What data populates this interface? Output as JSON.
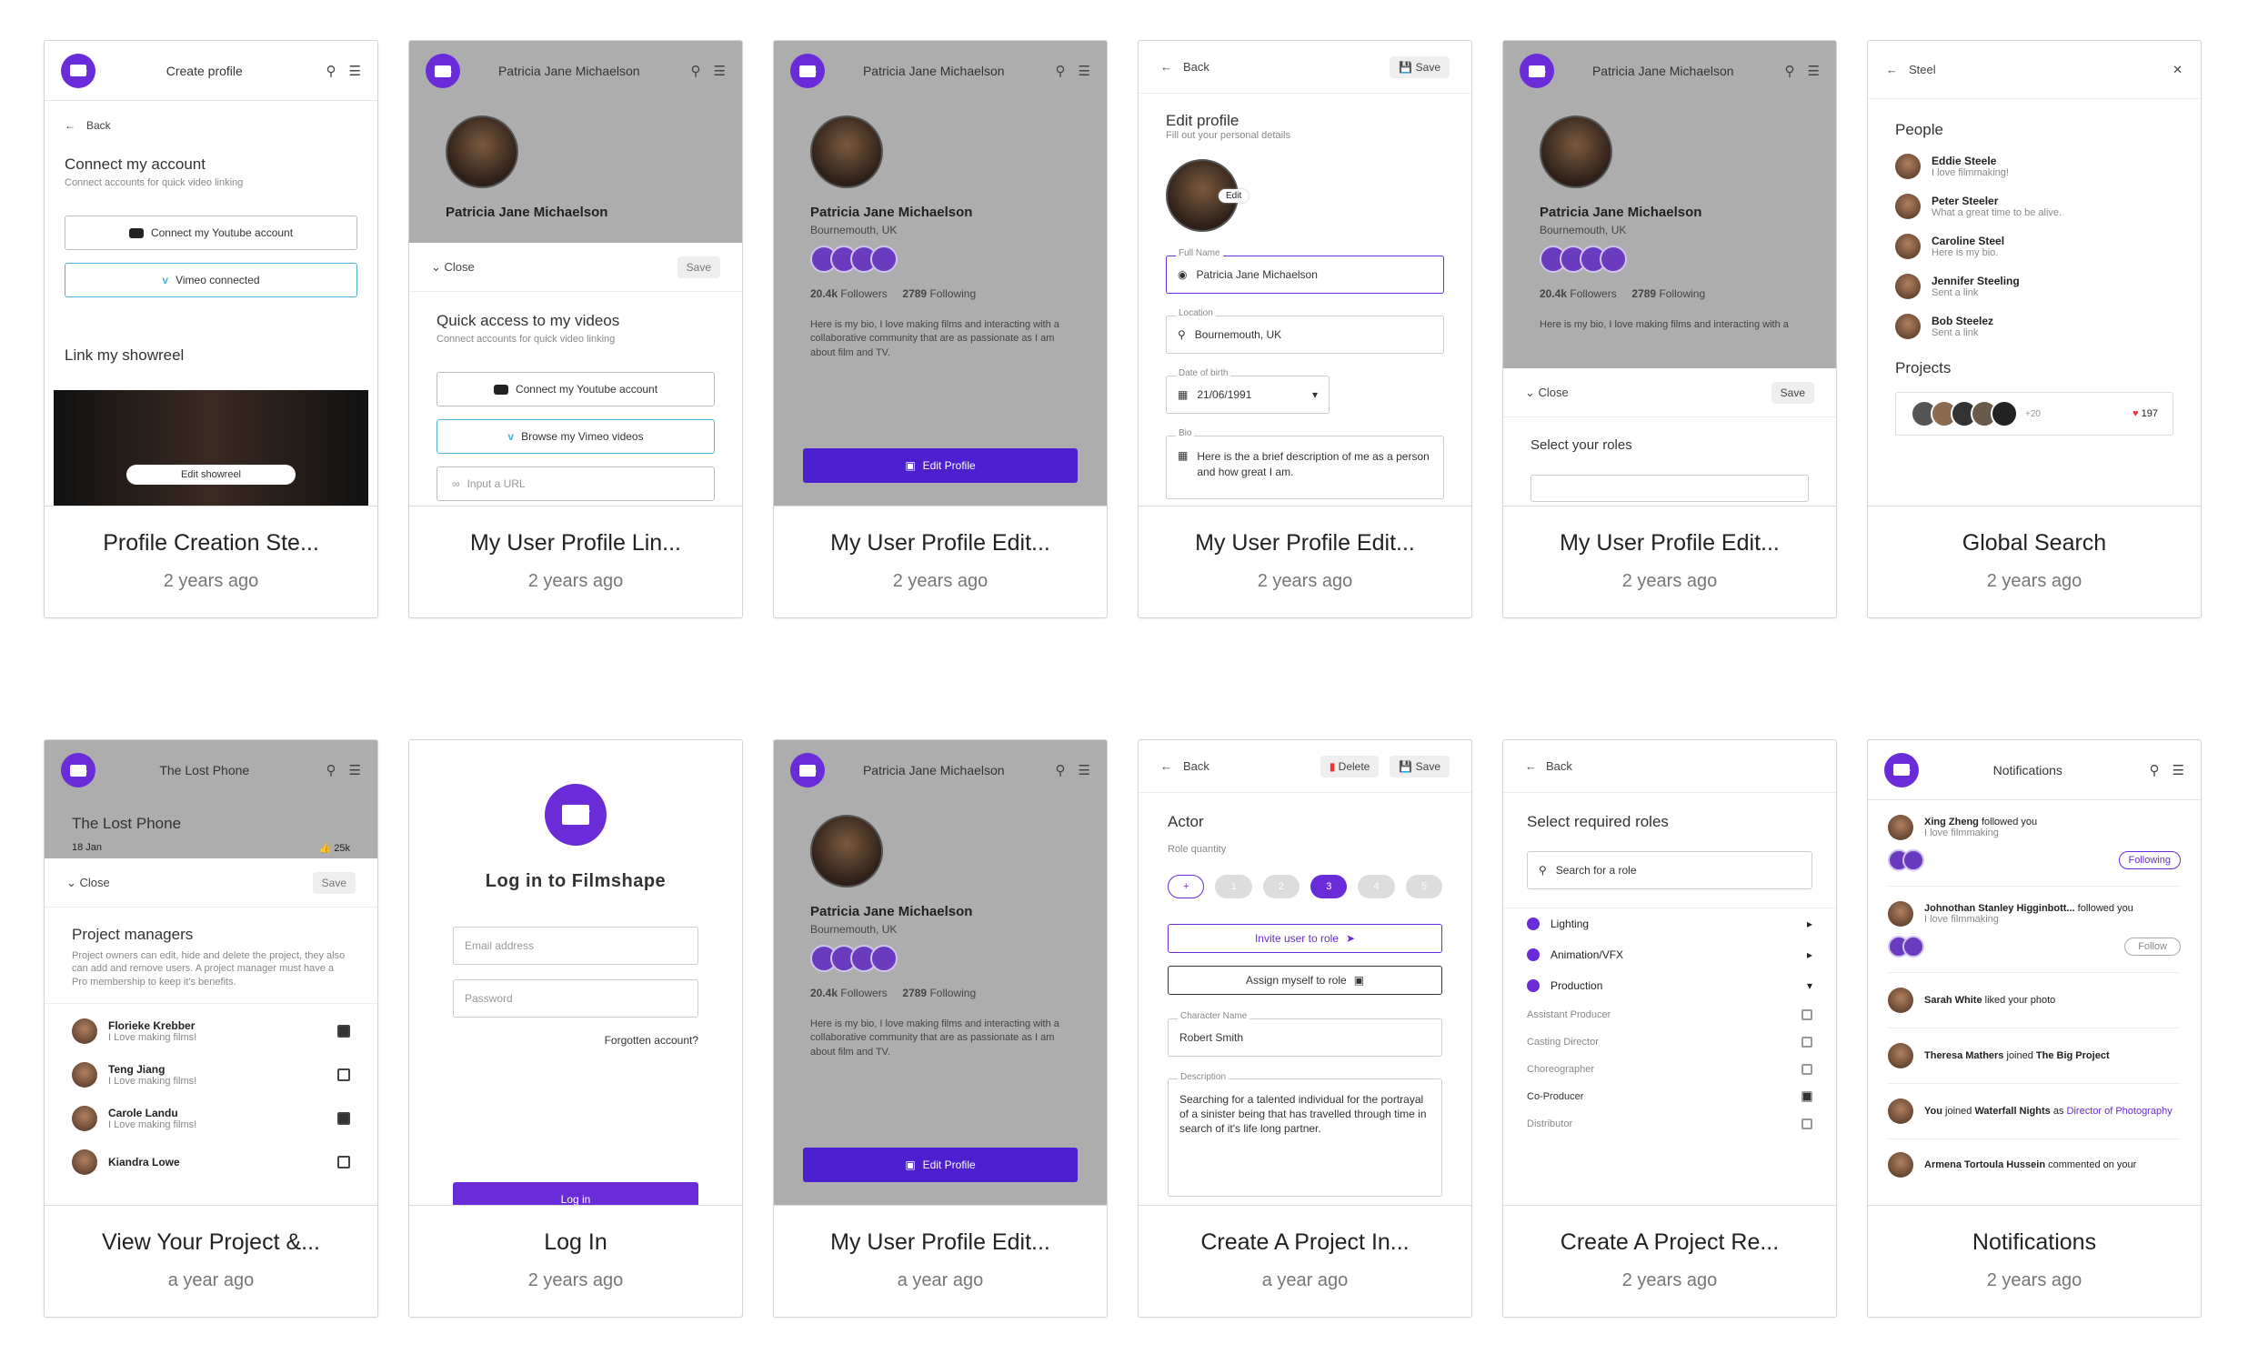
{
  "cards": [
    {
      "title": "Profile Creation Ste...",
      "date": "2 years ago"
    },
    {
      "title": "My User Profile Lin...",
      "date": "2 years ago"
    },
    {
      "title": "My User Profile Edit...",
      "date": "2 years ago"
    },
    {
      "title": "My User Profile Edit...",
      "date": "2 years ago"
    },
    {
      "title": "My User Profile Edit...",
      "date": "2 years ago"
    },
    {
      "title": "Global Search",
      "date": "2 years ago"
    },
    {
      "title": "View Your Project &...",
      "date": "a year ago"
    },
    {
      "title": "Log In",
      "date": "2 years ago"
    },
    {
      "title": "My User Profile Edit...",
      "date": "a year ago"
    },
    {
      "title": "Create A Project In...",
      "date": "a year ago"
    },
    {
      "title": "Create A Project Re...",
      "date": "2 years ago"
    },
    {
      "title": "Notifications",
      "date": "2 years ago"
    }
  ],
  "s1": {
    "header": "Create profile",
    "back": "Back",
    "connect_title": "Connect my account",
    "connect_sub": "Connect accounts for quick video linking",
    "youtube": "Connect my Youtube account",
    "vimeo": "Vimeo connected",
    "showreel": "Link my showreel",
    "edit_showreel": "Edit showreel"
  },
  "profile": {
    "name": "Patricia Jane Michaelson",
    "location": "Bournemouth, UK",
    "followers_n": "20.4k",
    "followers_l": "Followers",
    "following_n": "2789",
    "following_l": "Following",
    "bio": "Here is my bio, I love making films and interacting with  a collaborative community that are as passionate as I am about film and TV.",
    "edit": "Edit Profile"
  },
  "s2": {
    "close": "Close",
    "save": "Save",
    "title": "Quick access to my videos",
    "sub": "Connect accounts for quick video linking",
    "youtube": "Connect my Youtube account",
    "vimeo": "Browse my Vimeo videos",
    "url": "Input a URL"
  },
  "s4": {
    "back": "Back",
    "save": "Save",
    "title": "Edit profile",
    "sub": "Fill out your personal details",
    "edit": "Edit",
    "name_label": "Full Name",
    "name": "Patricia Jane Michaelson",
    "loc_label": "Location",
    "loc": "Bournemouth, UK",
    "dob_label": "Date of birth",
    "dob": "21/06/1991",
    "bio_label": "Bio",
    "bio": "Here is the a brief description of me as a person and how great I am."
  },
  "s5": {
    "close": "Close",
    "save": "Save",
    "roles": "Select your roles"
  },
  "s6": {
    "query": "Steel",
    "people": "People",
    "items": [
      {
        "name": "Eddie Steele",
        "text": "I love filmmaking!"
      },
      {
        "name": "Peter Steeler",
        "text": "What a great time to be alive."
      },
      {
        "name": "Caroline Steel",
        "text": "Here is my bio."
      },
      {
        "name": "Jennifer Steeling",
        "text": "Sent a link"
      },
      {
        "name": "Bob Steelez",
        "text": "Sent a link"
      }
    ],
    "projects": "Projects",
    "more": "+20",
    "likes": "197"
  },
  "s7": {
    "header": "The Lost Phone",
    "title": "The Lost Phone",
    "date": "18 Jan",
    "likes": "25k",
    "close": "Close",
    "save": "Save",
    "pm": "Project managers",
    "pm_sub": "Project owners can edit, hide and delete the project, they also can add and remove users. A project manager must have a Pro membership to keep it's benefits.",
    "members": [
      {
        "name": "Florieke Krebber",
        "text": "I Love making films!",
        "on": true
      },
      {
        "name": "Teng Jiang",
        "text": "I Love making films!",
        "on": false
      },
      {
        "name": "Carole Landu",
        "text": "I Love making films!",
        "on": true
      },
      {
        "name": "Kiandra Lowe",
        "text": "",
        "on": false
      }
    ]
  },
  "s8": {
    "title": "Log in to Filmshape",
    "email": "Email address",
    "password": "Password",
    "forgot": "Forgotten account?",
    "login": "Log in"
  },
  "s10": {
    "back": "Back",
    "delete": "Delete",
    "save": "Save",
    "role": "Actor",
    "qty": "Role quantity",
    "steps": [
      "+",
      "1",
      "2",
      "3",
      "4",
      "5"
    ],
    "invite": "Invite user to role",
    "assign": "Assign myself to role",
    "char_label": "Character Name",
    "char": "Robert Smith",
    "desc_label": "Description",
    "desc": "Searching for a talented individual for the portrayal of a sinister being that has travelled through time in search of it's life long partner."
  },
  "s11": {
    "back": "Back",
    "title": "Select required roles",
    "search": "Search for a role",
    "cats": [
      "Lighting",
      "Animation/VFX",
      "Production"
    ],
    "roles": [
      {
        "name": "Assistant Producer",
        "on": false
      },
      {
        "name": "Casting Director",
        "on": false
      },
      {
        "name": "Choreographer",
        "on": false
      },
      {
        "name": "Co-Producer",
        "on": true
      },
      {
        "name": "Distributor",
        "on": false
      }
    ]
  },
  "s12": {
    "header": "Notifications",
    "n1_name": "Xing Zheng",
    "n1_act": "followed you",
    "n1_sub": "I love filmmaking",
    "following": "Following",
    "n2_name": "Johnothan Stanley Higginbott...",
    "n2_act": "followed you",
    "n2_sub": "I love filmmaking",
    "follow": "Follow",
    "n3_name": "Sarah White",
    "n3_act": "liked your photo",
    "n4_name": "Theresa Mathers",
    "n4_act": "joined",
    "n4_obj": "The Big Project",
    "n5_name": "You",
    "n5_act": "joined",
    "n5_obj": "Waterfall Nights",
    "n5_as": "as",
    "n5_role": "Director of Photography",
    "n6_name": "Armena Tortoula Hussein",
    "n6_act": "commented on your"
  }
}
